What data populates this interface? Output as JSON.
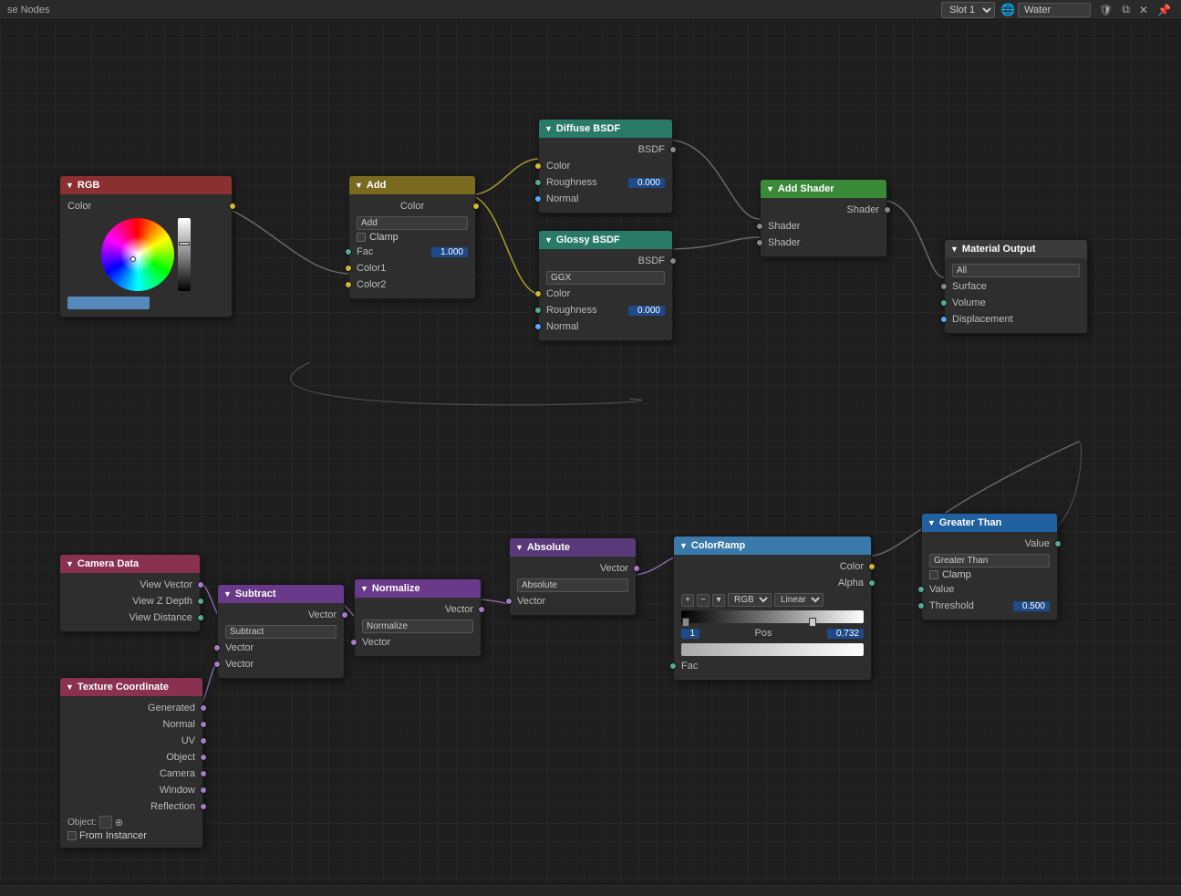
{
  "topbar": {
    "title": "se Nodes",
    "slot_label": "Slot 1",
    "material_name": "Water",
    "icons": [
      "shield",
      "copy",
      "x",
      "pin"
    ]
  },
  "nodes": {
    "rgb": {
      "title": "RGB",
      "outputs": [
        "Color"
      ],
      "color_preview": "#5588bb"
    },
    "add": {
      "title": "Add",
      "output": "Color",
      "mode": "Add",
      "clamp": false,
      "fac": "1.000",
      "inputs": [
        "Color1",
        "Color2"
      ]
    },
    "diffuse_bsdf": {
      "title": "Diffuse BSDF",
      "output": "BSDF",
      "inputs": [
        "Color",
        "Roughness",
        "Normal"
      ],
      "roughness": "0.000"
    },
    "glossy_bsdf": {
      "title": "Glossy BSDF",
      "output": "BSDF",
      "mode": "GGX",
      "inputs": [
        "Color",
        "Roughness",
        "Normal"
      ],
      "roughness": "0.000"
    },
    "add_shader": {
      "title": "Add Shader",
      "output": "Shader",
      "inputs": [
        "Shader",
        "Shader"
      ]
    },
    "material_output": {
      "title": "Material Output",
      "mode": "All",
      "outputs": [
        "Surface",
        "Volume",
        "Displacement"
      ]
    },
    "camera_data": {
      "title": "Camera Data",
      "outputs": [
        "View Vector",
        "View Z Depth",
        "View Distance"
      ]
    },
    "subtract": {
      "title": "Subtract",
      "output": "Vector",
      "mode": "Subtract",
      "inputs": [
        "Vector",
        "Vector"
      ]
    },
    "normalize": {
      "title": "Normalize",
      "output": "Vector",
      "mode": "Normalize",
      "inputs": [
        "Vector"
      ]
    },
    "absolute": {
      "title": "Absolute",
      "output": "Vector",
      "mode": "Absolute",
      "inputs": [
        "Vector"
      ]
    },
    "color_ramp": {
      "title": "ColorRamp",
      "outputs": [
        "Color",
        "Alpha"
      ],
      "inputs": [
        "Fac"
      ],
      "color_mode": "RGB",
      "interpolation": "Linear",
      "stop1_pos": "1",
      "stop1_val": "0.732"
    },
    "greater_than": {
      "title": "Greater Than",
      "output": "Value",
      "mode": "Greater Than",
      "clamp": false,
      "value": "",
      "threshold": "0.500"
    },
    "texture_coordinate": {
      "title": "Texture Coordinate",
      "outputs": [
        "Generated",
        "Normal",
        "UV",
        "Object",
        "Camera",
        "Window",
        "Reflection"
      ],
      "object": "",
      "from_instancer": false
    }
  },
  "labels": {
    "color": "Color",
    "roughness": "Roughness",
    "normal": "Normal",
    "bsdf": "BSDF",
    "shader": "Shader",
    "vector": "Vector",
    "fac": "Fac",
    "value": "Value",
    "threshold": "Threshold",
    "alpha": "Alpha",
    "surface": "Surface",
    "volume": "Volume",
    "displacement": "Displacement",
    "view_vector": "View Vector",
    "view_z_depth": "View Z Depth",
    "view_distance": "View Distance",
    "generated": "Generated",
    "normal_out": "Normal",
    "uv": "UV",
    "object_out": "Object",
    "camera_out": "Camera",
    "window": "Window",
    "reflection": "Reflection",
    "object_label": "Object:",
    "from_instancer": "From Instancer",
    "clamp": "Clamp",
    "add_mode": "Add",
    "subtract_mode": "Subtract",
    "normalize_mode": "Normalize",
    "absolute_mode": "Absolute",
    "ggx_mode": "GGX",
    "greater_than_mode": "Greater Than",
    "all_mode": "All",
    "rgb_linear": "Linear",
    "rgb_mode": "RGB",
    "color1": "Color1",
    "color2": "Color2",
    "pos": "Pos",
    "stop_index": "1",
    "stop_pos": "0.732"
  }
}
